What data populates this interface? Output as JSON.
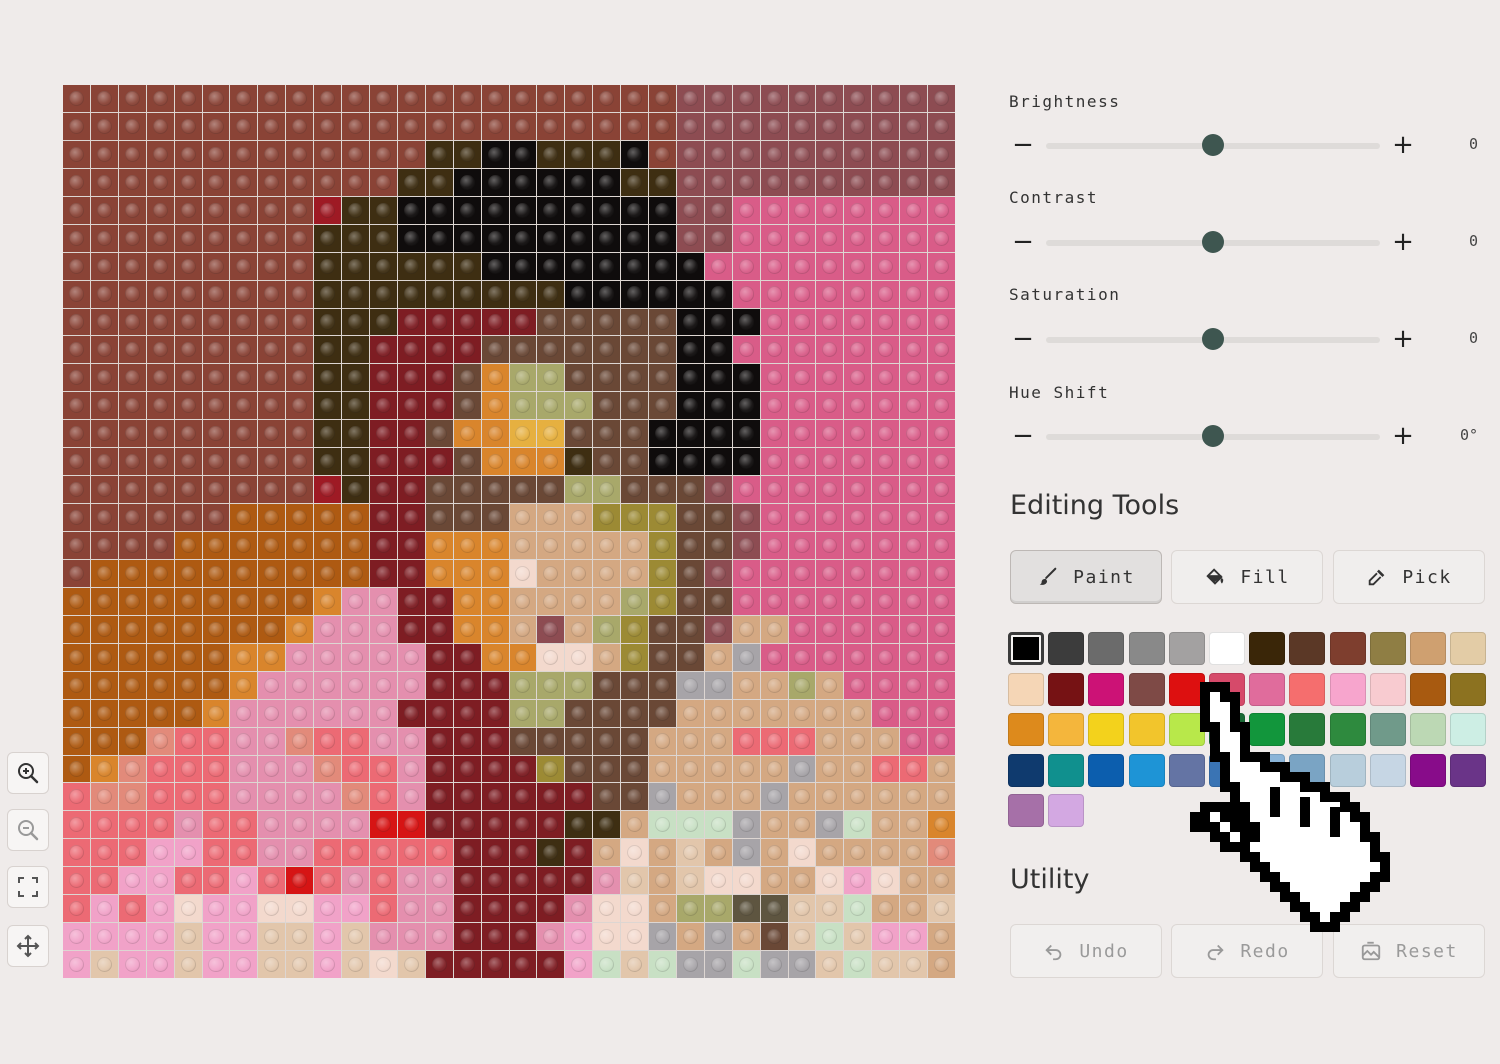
{
  "mosaic": {
    "palette": {
      "a": "#8a4336",
      "b": "#8d4c52",
      "c": "#0f0c0c",
      "d": "#3e2e12",
      "e": "#7a4a32",
      "f": "#d95c88",
      "g": "#9e1a24",
      "h": "#7e1d23",
      "i": "#ae5a12",
      "j": "#d9852c",
      "k": "#e6b040",
      "l": "#9c8a34",
      "m": "#d4a882",
      "n": "#a8a86a",
      "o": "#ec6a74",
      "p": "#e48fae",
      "q": "#f1a2c8",
      "r": "#e2c6ab",
      "s": "#a7a4a8",
      "t": "#c8e0c4",
      "u": "#d61414",
      "v": "#7f746e",
      "w": "#f3d9cd",
      "x": "#e28a7a",
      "y": "#6a4836",
      "z": "#5e5540",
      "R": "#b6624c",
      "Q": "#ea6b88"
    },
    "rows": [
      "aaaaaaaaaaaaaaaaaaaaaabbbbbbbbbb",
      "aaaaaaaaaaaaaaaaaaaaaabbbbbbbbbb",
      "aaaaaaaaaaaaaddccdddcabbbbbbbbbb",
      "aaaaaaaaaaaaddccccccddbbbbbbbbbb",
      "aaaaaaaaagddccccccccccbbffffffff",
      "aaaaaaaaadddccccccccccbbffffffff",
      "aaaaaaaaaddddddccccccccfffffffff",
      "aaaaaaaaadddddddddccccccfffffffff",
      "aaaaaaaaadddhhhhhyyyyycccfffffff",
      "aaaaaaaaaddhhhhyyyyyyyccffffffff",
      "aaaaaaaaaddhhhyjnnyyyycccfffffff",
      "aaaaaaaaaddhhhyjnnnyyycccfffffff",
      "aaaaaaaaaddhhyjjkkyyyccccfffffff",
      "aaaaaaaaaddhhhyjjjdyyccccfffffff",
      "aaaaaaaaagdhhyyyyynnyyybffffffff",
      "aaaaaaiiiiihhyyymmmlllyybfffffff",
      "aaaaiiiiiiihhjjjmmmmmlyybfffffff",
      "aiiiiiiiiiihhjjjwmmmmlybffffffff",
      "iiiiiiiiijpphhjjmmmmnlyyffffffff",
      "iiiiiiiijppphhjjmbmnlyybmmffffff",
      "iiiiiijjppppphhjjwwmlyymsfffffff",
      "iiiiiijpppppphhhnnnyyyssmmnmffff",
      "iiiiijpppppphhhhnnyyyymmmmmmmfff",
      "iiixooppxoopphhhyyyyymmmooommmff",
      "ijxooopppxoophhhhlyyymmmmmsmmoom",
      "oxxoooppppxophhhhhhyysmmmsmmmmmm",
      "oooopooppppuuhhhhhddmtttsmmstmmj",
      "oooqqooppooooohhhdhmwmrmsmwmmmmx",
      "ooqqooqouopopphhhhhprmrwwmmwqwmm",
      "oqoqwqqwwqqopphhhhpwwmnnzzrrtmmr",
      "qqqqrqqrrqrppphhhpqwwsmsmyrtrqqm",
      "qrqqrqqrrqrwrhhhhhqtrtsstssrtrrm"
    ]
  },
  "zoom_tools": [
    {
      "name": "zoom-in-icon"
    },
    {
      "name": "zoom-out-icon"
    },
    {
      "name": "fit-screen-icon"
    },
    {
      "name": "pan-move-icon"
    }
  ],
  "adjustments": [
    {
      "label": "Brightness",
      "value": "0",
      "level": 0.5
    },
    {
      "label": "Contrast",
      "value": "0",
      "level": 0.5
    },
    {
      "label": "Saturation",
      "value": "0",
      "level": 0.5
    },
    {
      "label": "Hue Shift",
      "value": "0°",
      "level": 0.5
    }
  ],
  "slider_minus": "−",
  "slider_plus": "+",
  "editing_tools": {
    "title": "Editing Tools",
    "tools": [
      {
        "label": "Paint",
        "icon": "brush-icon",
        "active": true
      },
      {
        "label": "Fill",
        "icon": "paint-bucket-icon",
        "active": false
      },
      {
        "label": "Pick",
        "icon": "eyedropper-icon",
        "active": false
      }
    ],
    "palette": [
      "#000000",
      "#3c3c3c",
      "#6b6b6b",
      "#898989",
      "#a3a1a1",
      "#ffffff",
      "#3a2608",
      "#5b3826",
      "#7e3e2e",
      "#8f7e44",
      "#cfa070",
      "#e3cca6",
      "#f5d6b6",
      "#761214",
      "#cc1276",
      "#7e4a46",
      "#dd1010",
      "#d64a6a",
      "#e06c9c",
      "#f56e6e",
      "#f7a5cd",
      "#f8cbd0",
      "#a85a10",
      "#8c7220",
      "#dd8a1c",
      "#f4b63c",
      "#f3d21c",
      "#f2c52c",
      "#b8e84a",
      "#1a6a36",
      "#12963c",
      "#287a3a",
      "#2e8a3e",
      "#709a8a",
      "#bcd8b4",
      "#cdeee4",
      "#0f3a6e",
      "#10908e",
      "#0c5eae",
      "#1e94d6",
      "#6474a4",
      "#3a74b4",
      "#8ab4d8",
      "#7aa4c4",
      "#b8cedc",
      "#c6d6e4",
      "#880c8a",
      "#6a3488",
      "#a670a8",
      "#d3a8e2"
    ],
    "selected_index": 0
  },
  "utility": {
    "title": "Utility",
    "buttons": [
      {
        "label": "Undo",
        "icon": "undo-icon"
      },
      {
        "label": "Redo",
        "icon": "redo-icon"
      },
      {
        "label": "Reset",
        "icon": "reset-image-icon"
      }
    ]
  },
  "cursor": {
    "icon": "hand-pointer-cursor-icon"
  }
}
